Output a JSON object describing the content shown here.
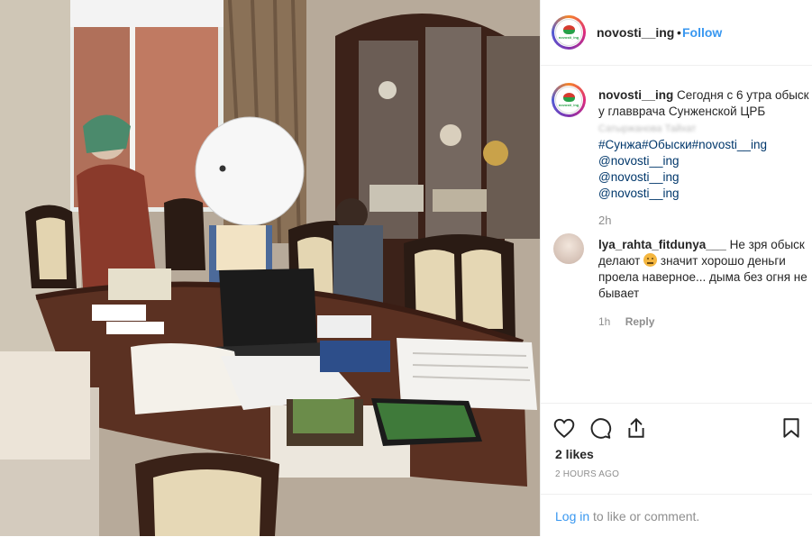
{
  "post": {
    "username": "novosti__ing",
    "follow_label": "Follow",
    "dot": "•",
    "avatar_logo_text": "novosti_ing",
    "photo_icon": "photo-scene"
  },
  "caption": {
    "username": "novosti__ing",
    "text": "Сегодня с 6 утра обыск у главврача Сунженской ЦРБ",
    "blurred_line": "Сатыржанова Тайхат",
    "hashtags": "#Сунжа#Обыски#novosti__ing",
    "mentions": [
      "@novosti__ing",
      "@novosti__ing",
      "@novosti__ing"
    ],
    "time": "2h"
  },
  "comment": {
    "username": "lya_rahta_fitdunya___",
    "text_before_emoji": "Не зря обыск делают",
    "text_after_emoji": "значит хорошо деньги проела наверное... дыма без огня не бывает",
    "time": "1h",
    "reply_label": "Reply"
  },
  "actions": {
    "icons": [
      "heart-icon",
      "comment-icon",
      "share-icon",
      "bookmark-icon"
    ],
    "likes": "2 likes",
    "posted": "2 HOURS AGO"
  },
  "footer": {
    "login_label": "Log in",
    "rest": "to like or comment."
  }
}
